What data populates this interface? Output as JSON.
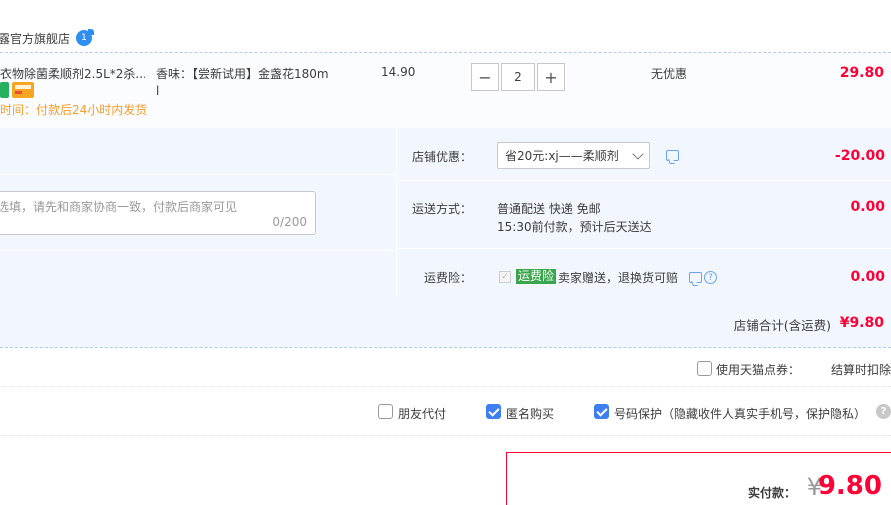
{
  "shop": {
    "name": "露官方旗舰店",
    "badge": "1"
  },
  "item": {
    "title": "衣物除菌柔顺剂2.5L*2杀...",
    "ship_time": "时间：付款后24小时内发货",
    "sku": "香味：【尝新试用】金盏花180m",
    "sku_cont": "l",
    "unit_price": "14.90",
    "quantity": "2",
    "qty_minus": "−",
    "qty_plus": "+",
    "discount": "无优惠",
    "subtotal": "29.80"
  },
  "memo": {
    "placeholder": "选填，请先和商家协商一致，付款后商家可见",
    "count": "0/200"
  },
  "shop_discount": {
    "label": "店铺优惠：",
    "selected": "省20元:xj——柔顺剂",
    "amount": "-20.00"
  },
  "shipping": {
    "label": "运送方式：",
    "line1": "普通配送 快递 免邮",
    "line2": "15:30前付款，预计后天送达",
    "amount": "0.00"
  },
  "insurance": {
    "label": "运费险：",
    "check_mark": "✓",
    "tag": "运费险",
    "text": "卖家赠送，退换货可赔",
    "help": "?",
    "amount": "0.00"
  },
  "shop_total": {
    "label": "店铺合计(含运费)",
    "value": "¥9.80"
  },
  "coupon": {
    "label": "使用天猫点券：",
    "note": "结算时扣除"
  },
  "flags": {
    "friend_pay": "朋友代付",
    "anonymous": "匿名购买",
    "number_protect": "号码保护（隐藏收件人真实手机号，保护隐私）",
    "help": "?"
  },
  "payment": {
    "label": "实付款：",
    "currency": "¥",
    "total": "9.80"
  },
  "colors": {
    "price_red": "#ff0036",
    "ship_orange": "#f79d2c",
    "accent_blue": "#3d7ef0",
    "panel_bg": "#f2f7ff",
    "insurance_green": "#3aa64b"
  },
  "icons": [
    "shop-info-icon",
    "tmall-green-icon",
    "card-pay-icon",
    "chevron-down-icon",
    "message-icon",
    "question-icon",
    "help-icon"
  ]
}
